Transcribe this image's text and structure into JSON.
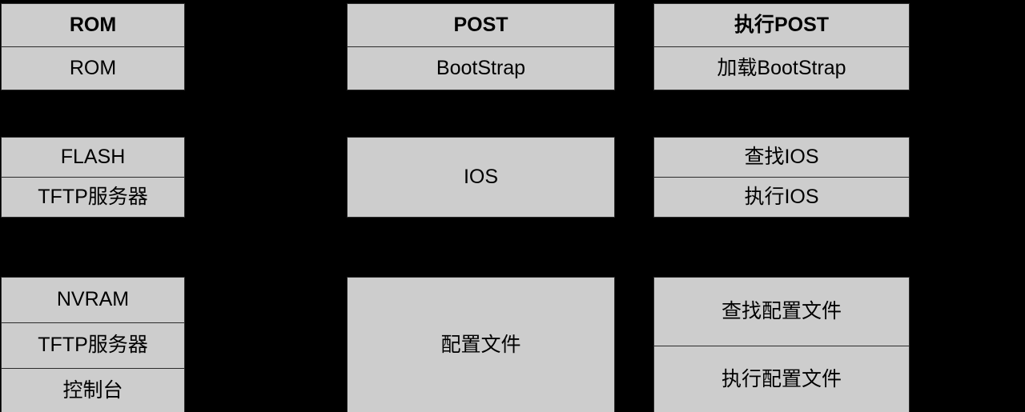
{
  "diagram": {
    "title": "Cisco Router Boot Sequence Diagram",
    "background_color": "#000000",
    "box_fill_color": "#cdcdcd",
    "border_color": "#2b2b2b",
    "columns": [
      {
        "id": "sources",
        "groups": [
          {
            "id": "rom-group",
            "cells": [
              {
                "text": "ROM",
                "style": "header"
              },
              {
                "text": "ROM",
                "style": "body"
              }
            ]
          },
          {
            "id": "flash-group",
            "cells": [
              {
                "text": "FLASH",
                "style": "body"
              },
              {
                "text": "TFTP服务器",
                "style": "body"
              }
            ]
          },
          {
            "id": "nvram-group",
            "cells": [
              {
                "text": "NVRAM",
                "style": "body"
              },
              {
                "text": "TFTP服务器",
                "style": "body"
              },
              {
                "text": "控制台",
                "style": "body"
              }
            ]
          }
        ]
      },
      {
        "id": "components",
        "groups": [
          {
            "id": "post-group",
            "cells": [
              {
                "text": "POST",
                "style": "header"
              },
              {
                "text": "BootStrap",
                "style": "body"
              }
            ]
          },
          {
            "id": "ios-group",
            "cells": [
              {
                "text": "IOS",
                "style": "body"
              }
            ]
          },
          {
            "id": "config-group",
            "cells": [
              {
                "text": "配置文件",
                "style": "body"
              }
            ]
          }
        ]
      },
      {
        "id": "actions",
        "groups": [
          {
            "id": "exec-post-group",
            "cells": [
              {
                "text": "执行POST",
                "style": "header"
              },
              {
                "text": "加载BootStrap",
                "style": "body"
              }
            ]
          },
          {
            "id": "ios-actions-group",
            "cells": [
              {
                "text": "查找IOS",
                "style": "body"
              },
              {
                "text": "执行IOS",
                "style": "body"
              }
            ]
          },
          {
            "id": "config-actions-group",
            "cells": [
              {
                "text": "查找配置文件",
                "style": "body"
              },
              {
                "text": "执行配置文件",
                "style": "body"
              }
            ]
          }
        ]
      }
    ]
  }
}
